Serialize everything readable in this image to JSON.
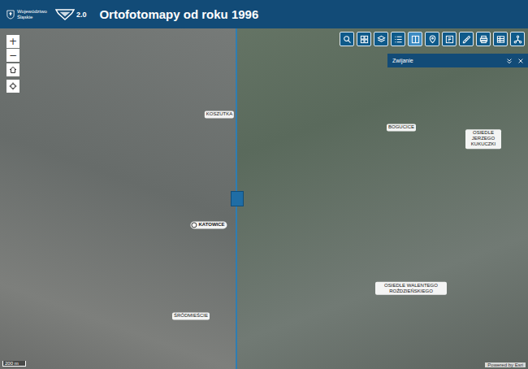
{
  "header": {
    "logo_lines": [
      "Województwo",
      "Śląskie"
    ],
    "version": "2.0",
    "title": "Ortofotomapy od roku 1996"
  },
  "map_controls": [
    {
      "label": "+"
    },
    {
      "label": "−"
    }
  ],
  "tools": [
    {
      "selected": false
    },
    {
      "selected": false
    },
    {
      "selected": false
    },
    {
      "selected": false
    },
    {
      "selected": true
    },
    {
      "selected": false
    },
    {
      "selected": false
    },
    {
      "selected": false
    },
    {
      "selected": false
    },
    {
      "selected": false
    },
    {
      "selected": false
    }
  ],
  "panel": {
    "title": "Zwijanie"
  },
  "swipe": {
    "level": 0.448
  },
  "labels": [
    {
      "text": "KOSZUTKA",
      "kind": "district"
    },
    {
      "text": "KATOWICE",
      "kind": "city"
    },
    {
      "text": "BOGUCICE",
      "kind": "district"
    },
    {
      "text": "OSIEDLE JERZEGO KUKUCZKI",
      "kind": "district"
    },
    {
      "text": "OSIEDLE WALENTEGO ROŹDZIEŃSKIEGO",
      "kind": "district"
    },
    {
      "text": "ŚRÓDMIEŚCIE",
      "kind": "district"
    }
  ],
  "scale": "200 m",
  "attribution": "Powered by Esri"
}
